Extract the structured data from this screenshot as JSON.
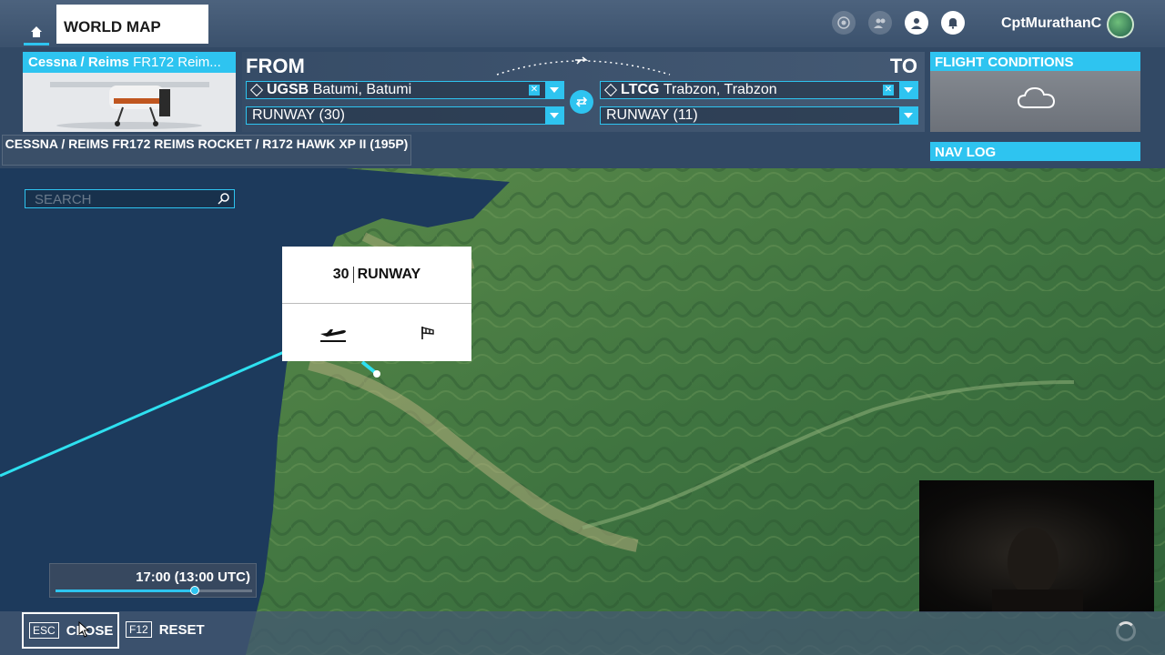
{
  "header": {
    "tab_label": "WORLD MAP",
    "username": "CptMurathanC",
    "icons": [
      "home-icon",
      "achievement-icon",
      "friends-icon",
      "profile-icon",
      "notification-icon"
    ]
  },
  "aircraft": {
    "brand": "Cessna / Reims",
    "model_short": "FR172 Reim...",
    "full_name": "CESSNA / REIMS FR172 REIMS ROCKET / R172 HAWK XP II (195P)"
  },
  "route": {
    "from_label": "FROM",
    "to_label": "TO",
    "from_icao": "UGSB",
    "from_name": "Batumi, Batumi",
    "from_runway": "RUNWAY (30)",
    "to_icao": "LTCG",
    "to_name": "Trabzon, Trabzon",
    "to_runway": "RUNWAY (11)"
  },
  "panels": {
    "flight_conditions": "FLIGHT CONDITIONS",
    "nav_log": "NAV LOG"
  },
  "search": {
    "placeholder": "SEARCH"
  },
  "popup": {
    "runway_number": "30",
    "runway_label": "RUNWAY"
  },
  "time": {
    "label": "17:00 (13:00 UTC)",
    "slider_fraction": 0.71
  },
  "footer": {
    "close_key": "ESC",
    "close_label": "CLOSE",
    "reset_key": "F12",
    "reset_label": "RESET"
  },
  "colors": {
    "accent": "#2ec4f0",
    "sea": "#1d3a5c",
    "land": "#4a7a3e"
  }
}
